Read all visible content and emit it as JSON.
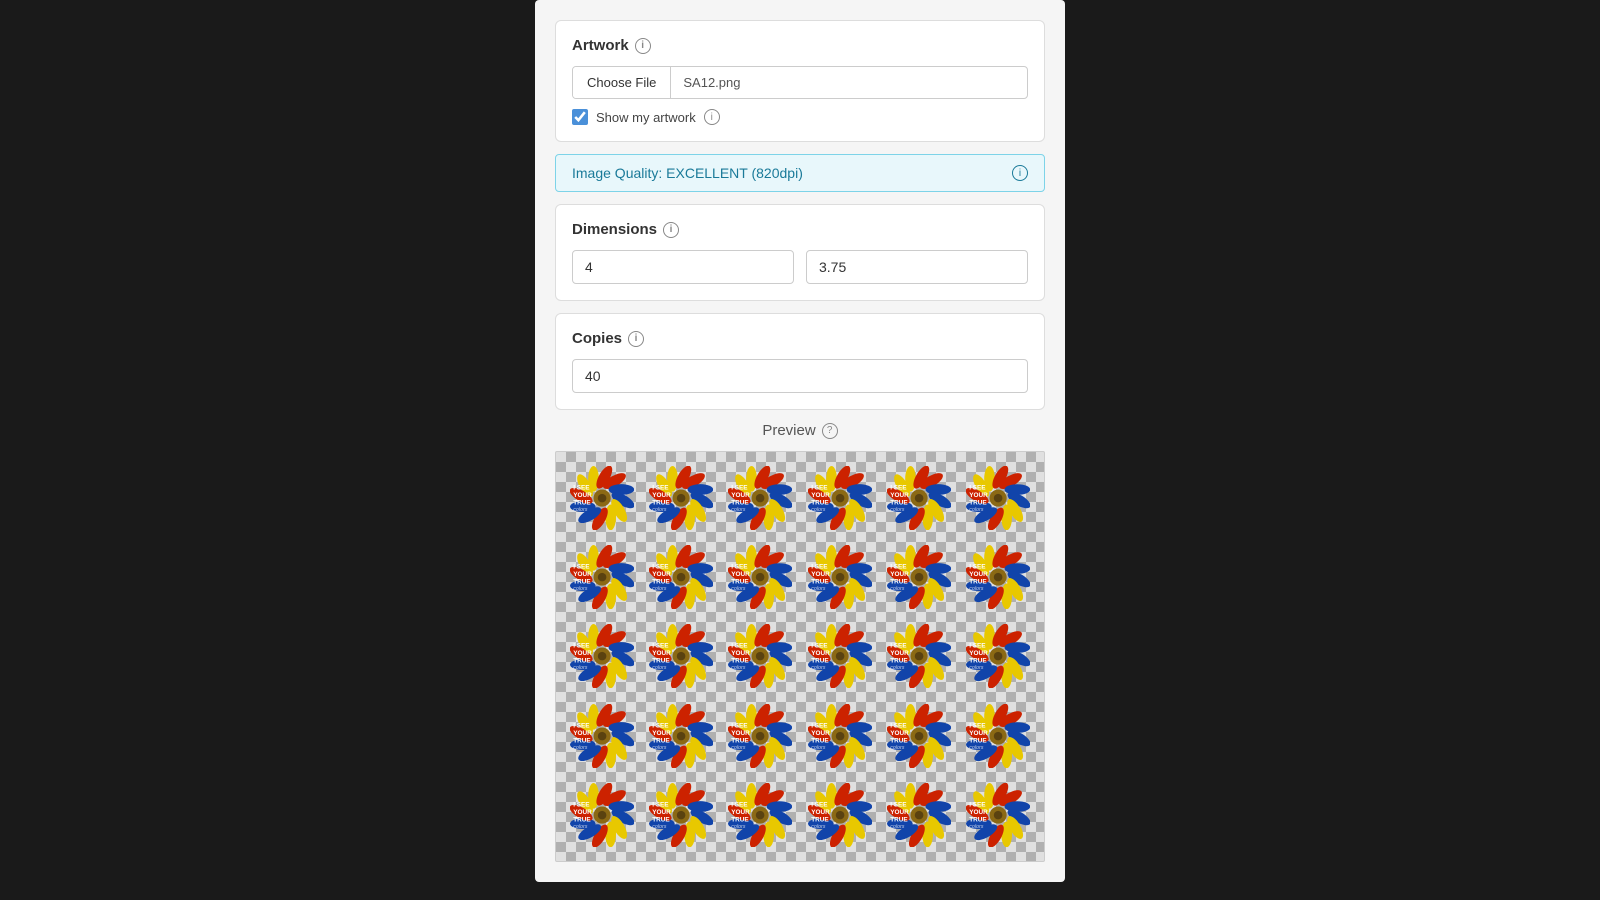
{
  "page": {
    "background": "#1a1a1a"
  },
  "artwork_section": {
    "title": "Artwork",
    "info_tooltip": "Information about artwork",
    "file_button_label": "Choose File",
    "file_name": "SA12.png",
    "show_artwork_label": "Show my artwork",
    "show_artwork_checked": true
  },
  "quality_banner": {
    "text": "Image Quality: EXCELLENT (820dpi)",
    "info_tooltip": "Information about image quality"
  },
  "dimensions_section": {
    "title": "Dimensions",
    "info_tooltip": "Information about dimensions",
    "width_value": "4",
    "height_value": "3.75"
  },
  "copies_section": {
    "title": "Copies",
    "info_tooltip": "Information about copies",
    "copies_value": "40"
  },
  "preview_section": {
    "title": "Preview",
    "info_tooltip": "Information about preview"
  },
  "sticker": {
    "text_line1": "I SEE",
    "text_line2": "YOUR",
    "text_line3": "TRUE",
    "text_colors": "colors"
  }
}
